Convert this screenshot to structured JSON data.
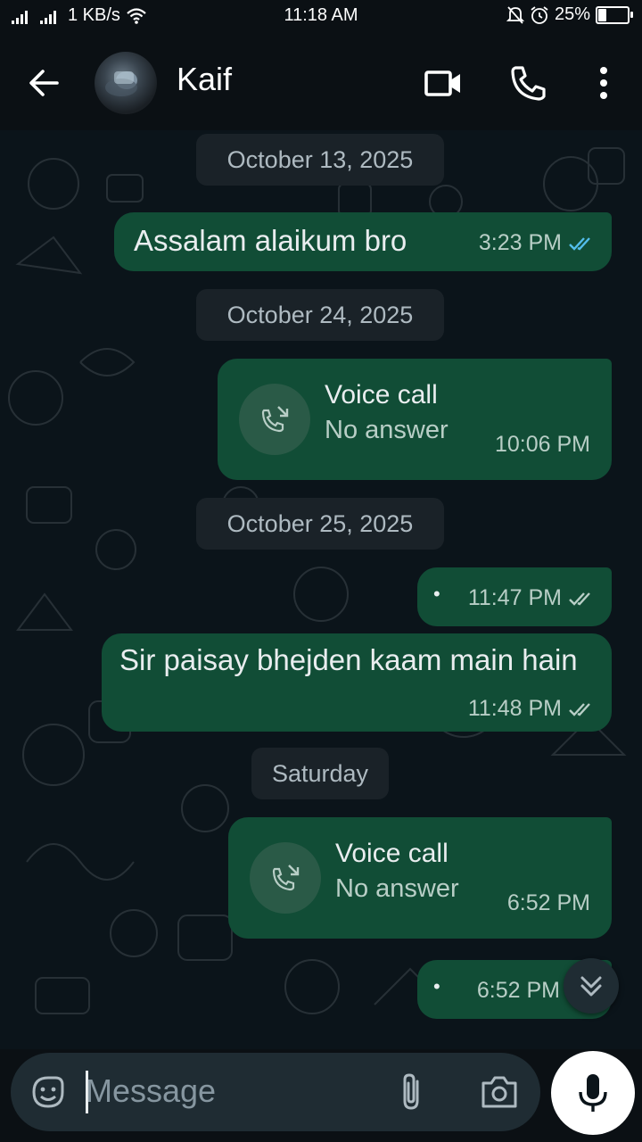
{
  "status_bar": {
    "network_speed": "1 KB/s",
    "time": "11:18 AM",
    "battery_percent": "25%",
    "battery_level": 0.25
  },
  "header": {
    "contact_name": "Kaif",
    "icons": [
      "back-arrow-icon",
      "video-call-icon",
      "phone-icon",
      "more-vert-icon"
    ]
  },
  "chat": {
    "date_1": "October 13, 2025",
    "msg_1": {
      "text": "Assalam alaikum  bro",
      "time": "3:23 PM",
      "status": "read"
    },
    "date_2": "October 24, 2025",
    "call_1": {
      "title": "Voice call",
      "subtitle": "No answer",
      "time": "10:06 PM"
    },
    "date_3": "October 25, 2025",
    "msg_2": {
      "text": "•",
      "time": "11:47 PM",
      "status": "delivered"
    },
    "msg_3": {
      "text": "Sir paisay bhejden kaam main hain",
      "time": "11:48 PM",
      "status": "delivered"
    },
    "date_4": "Saturday",
    "call_2": {
      "title": "Voice call",
      "subtitle": "No answer",
      "time": "6:52 PM"
    },
    "msg_4": {
      "text": "•",
      "time": "6:52 PM"
    }
  },
  "composer": {
    "placeholder": "Message"
  },
  "colors": {
    "background": "#0b141a",
    "outgoing_bubble": "#114d36",
    "read_tick": "#53bdeb",
    "date_chip": "#1a2228"
  }
}
